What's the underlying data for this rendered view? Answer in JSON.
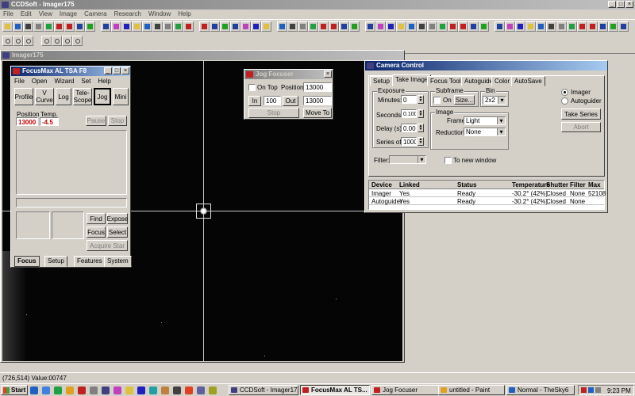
{
  "app": {
    "title": "CCDSoft - Imager175"
  },
  "menu": [
    "File",
    "Edit",
    "View",
    "Image",
    "Camera",
    "Research",
    "Window",
    "Help"
  ],
  "toolbar": {
    "row1_icons": [
      "new-icon",
      "open-icon",
      "save-icon",
      "print-icon",
      "undo-icon",
      "copy-icon",
      "paste-icon",
      "help-icon",
      "camera-icon",
      "link-icon",
      "unlink-icon",
      "arrow-up-icon",
      "arrow-down-icon",
      "arrow-left-icon",
      "arrow-right-icon",
      "crop-icon",
      "zoom-fit-icon",
      "play-icon",
      "stop-icon",
      "record-icon",
      "filter-icon",
      "settings-icon",
      "histogram-icon"
    ]
  },
  "child_window": {
    "title": "Imager175"
  },
  "statusbar": {
    "text": "(726,514) Value:00747"
  },
  "focusmax": {
    "title": "FocusMax   AL TSA F8",
    "menu": [
      "File",
      "Open",
      "Wizard",
      "Set",
      "Help"
    ],
    "buttons": [
      "Profile",
      "V Curve",
      "Log",
      "Tele-Scope",
      "Jog",
      "Mini"
    ],
    "position_label": "Position",
    "temp_label": "Temp.",
    "position_value": "13000",
    "temp_value": "-4.5",
    "pause": "Pause",
    "stop": "Stop",
    "find": "Find",
    "expose": "Expose",
    "focus": "Focus",
    "select": "Select",
    "acquire_star": "Acquire Star",
    "tabs": [
      "Focus",
      "Setup",
      "Features",
      "System"
    ]
  },
  "jog": {
    "title": "Jog Focuser",
    "on_top": "On Top",
    "position_label": "Position",
    "position_value": "13000",
    "in": "In",
    "step": "100",
    "out": "Out",
    "target": "13000",
    "stop": "Stop",
    "move_to": "Move To"
  },
  "camera": {
    "title": "Camera Control",
    "tabs": [
      "Setup",
      "Take Image",
      "Focus Tools",
      "Autoguide",
      "Color",
      "AutoSave"
    ],
    "exposure_group": "Exposure",
    "minutes_label": "Minutes:",
    "minutes": "0",
    "seconds_label": "Seconds:",
    "seconds": "0.100",
    "delay_label": "Delay (s):",
    "delay": "0.00",
    "series_label": "Series of:",
    "series": "1000",
    "subframe_group": "Subframe",
    "on": "On",
    "size": "Size...",
    "bin_group": "Bin",
    "bin": "2x2",
    "image_group": "Image",
    "frame_label": "Frame:",
    "frame": "Light",
    "reduction_label": "Reduction:",
    "reduction": "None",
    "filter_label": "Filter:",
    "new_window": "To new window",
    "imager": "Imager",
    "autoguider": "Autoguider",
    "take_series": "Take Series",
    "abort": "Abort",
    "table": {
      "headers": [
        "Device",
        "Linked",
        "Status",
        "Temperature",
        "Shutter",
        "Filter",
        "Max"
      ],
      "rows": [
        [
          "Imager",
          "Yes",
          "Ready",
          "-30.2° (42%)",
          "Closed",
          "None",
          "52108"
        ],
        [
          "Autoguider",
          "Yes",
          "Ready",
          "-30.2° (42%)",
          "Closed",
          "None",
          ""
        ]
      ]
    }
  },
  "taskbar": {
    "start": "Start",
    "tasks": [
      "CCDSoft - Imager175",
      "FocusMax  AL TS...",
      "Jog Focuser",
      "untitled - Paint",
      "Normal - TheSky6"
    ],
    "clock": "9:23 PM"
  }
}
